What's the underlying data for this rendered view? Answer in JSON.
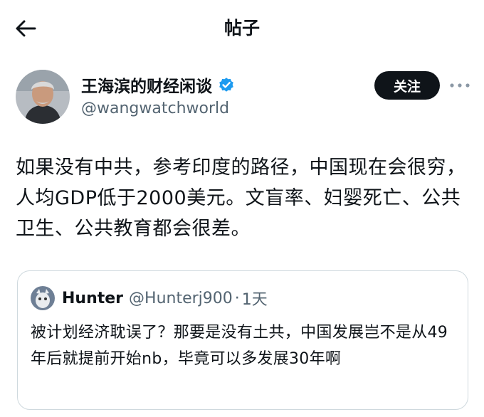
{
  "header": {
    "title": "帖子",
    "back_icon": "back-arrow-icon"
  },
  "post": {
    "author": {
      "display_name": "王海滨的财经闲谈",
      "handle": "@wangwatchworld",
      "verified": true
    },
    "follow_label": "关注",
    "more_icon": "more-dots-icon",
    "text": "如果没有中共，参考印度的路径，中国现在会很穷，人均GDP低于2000美元。文盲率、妇婴死亡、公共卫生、公共教育都会很差。"
  },
  "quoted_post": {
    "author": {
      "display_name": "Hunter",
      "handle": "@Hunterj900",
      "separator": "·",
      "time": "1天"
    },
    "text": "被计划经济耽误了？那要是没有土共，中国发展岂不是从49年后就提前开始nb，毕竟可以多发展30年啊"
  },
  "colors": {
    "text_primary": "#0f1419",
    "text_secondary": "#536471",
    "verified_blue": "#1d9bf0",
    "border": "#cfd9de",
    "follow_bg": "#0f1419"
  }
}
